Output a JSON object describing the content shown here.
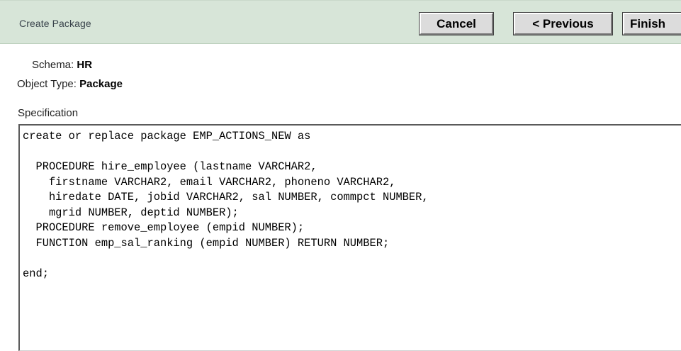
{
  "header": {
    "title": "Create Package",
    "buttons": {
      "cancel": "Cancel",
      "previous": "< Previous",
      "finish": "Finish"
    }
  },
  "fields": {
    "schema": {
      "label": "Schema:",
      "value": "HR"
    },
    "object_type": {
      "label": "Object Type:",
      "value": "Package"
    }
  },
  "specification": {
    "label": "Specification",
    "code": "create or replace package EMP_ACTIONS_NEW as\n\n  PROCEDURE hire_employee (lastname VARCHAR2,\n    firstname VARCHAR2, email VARCHAR2, phoneno VARCHAR2,\n    hiredate DATE, jobid VARCHAR2, sal NUMBER, commpct NUMBER,\n    mgrid NUMBER, deptid NUMBER);\n  PROCEDURE remove_employee (empid NUMBER);\n  FUNCTION emp_sal_ranking (empid NUMBER) RETURN NUMBER;\n\nend;"
  }
}
